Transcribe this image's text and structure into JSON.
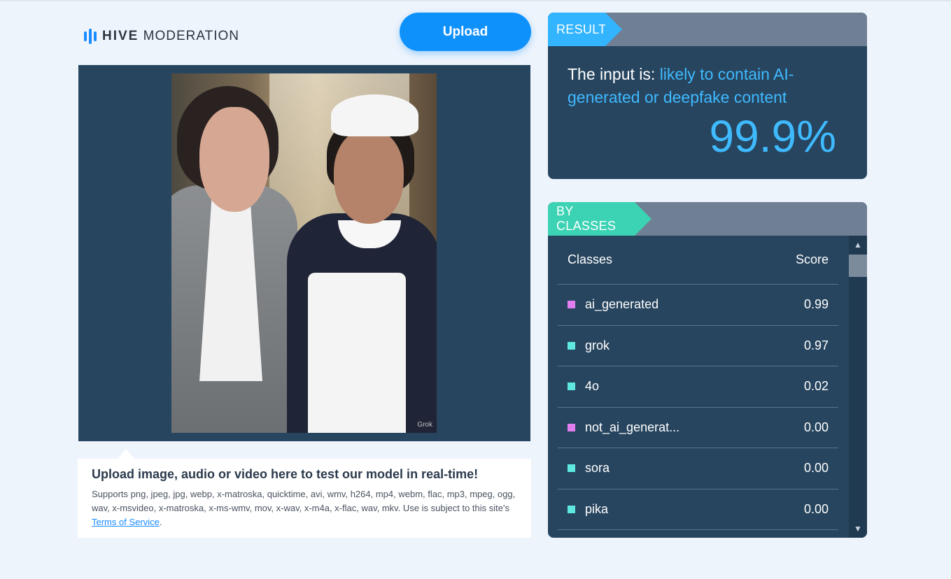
{
  "logo": {
    "brand_bold": "HIVE",
    "brand_light": "MODERATION"
  },
  "upload": {
    "label": "Upload"
  },
  "image": {
    "watermark": "Grok"
  },
  "info": {
    "title": "Upload image, audio or video here to test our model in real-time!",
    "text": "Supports png, jpeg, jpg, webp, x-matroska, quicktime, avi, wmv, h264, mp4, webm, flac, mp3, mpeg, ogg, wav, x-msvideo, x-matroska, x-ms-wmv, mov, x-wav, x-m4a, x-flac, wav, mkv. Use is subject to this site's ",
    "link": "Terms of Service",
    "suffix": "."
  },
  "result": {
    "tag": "RESULT",
    "prefix": "The input is: ",
    "verdict": "likely to contain AI-generated or deepfake content",
    "percent": "99.9%"
  },
  "classes": {
    "tag": "BY CLASSES",
    "col_class": "Classes",
    "col_score": "Score",
    "rows": [
      {
        "name": "ai_generated",
        "score": "0.99",
        "color": "#e07ef0"
      },
      {
        "name": "grok",
        "score": "0.97",
        "color": "#5fe8e0"
      },
      {
        "name": "4o",
        "score": "0.02",
        "color": "#5fe8e0"
      },
      {
        "name": "not_ai_generat...",
        "score": "0.00",
        "color": "#e07ef0"
      },
      {
        "name": "sora",
        "score": "0.00",
        "color": "#5fe8e0"
      },
      {
        "name": "pika",
        "score": "0.00",
        "color": "#5fe8e0"
      }
    ]
  },
  "icons": {
    "scroll_up": "chevron-up-icon",
    "scroll_down": "chevron-down-icon",
    "logo": "hive-bars-icon"
  },
  "colors": {
    "accent": "#0f91fb",
    "result_tag": "#32b4ff",
    "classes_tag": "#3cd2b4",
    "panel": "#27455f"
  }
}
